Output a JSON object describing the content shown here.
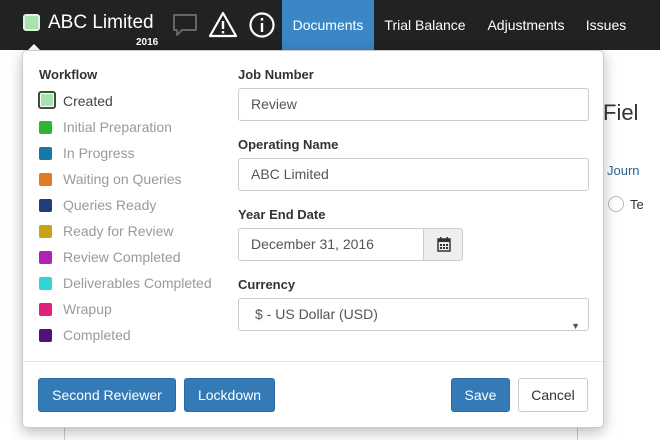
{
  "navbar": {
    "company_name": "ABC Limited",
    "year": "2016",
    "brand_color": "#a8e3ac",
    "icons": [
      "chat-icon",
      "warning-icon",
      "info-icon"
    ],
    "tabs": [
      {
        "label": "Documents",
        "active": true
      },
      {
        "label": "Trial Balance",
        "active": false
      },
      {
        "label": "Adjustments",
        "active": false
      },
      {
        "label": "Issues",
        "active": false
      }
    ]
  },
  "background": {
    "heading": "Fiel",
    "link": "Journ",
    "radio_label": "Te"
  },
  "popover": {
    "workflow_title": "Workflow",
    "workflow": [
      {
        "label": "Created",
        "color": "#a8e3ac",
        "selected": true
      },
      {
        "label": "Initial Preparation",
        "color": "#2db52d",
        "selected": false
      },
      {
        "label": "In Progress",
        "color": "#1578a8",
        "selected": false
      },
      {
        "label": "Waiting on Queries",
        "color": "#e07a25",
        "selected": false
      },
      {
        "label": "Queries Ready",
        "color": "#1f3f7a",
        "selected": false
      },
      {
        "label": "Ready for Review",
        "color": "#c9a215",
        "selected": false
      },
      {
        "label": "Review Completed",
        "color": "#b41fb4",
        "selected": false
      },
      {
        "label": "Deliverables Completed",
        "color": "#2fd6d6",
        "selected": false
      },
      {
        "label": "Wrapup",
        "color": "#e01f7a",
        "selected": false
      },
      {
        "label": "Completed",
        "color": "#4f1080",
        "selected": false
      }
    ],
    "job_number_label": "Job Number",
    "job_number_value": "Review",
    "operating_name_label": "Operating Name",
    "operating_name_value": "ABC Limited",
    "year_end_label": "Year End Date",
    "year_end_value": "December 31, 2016",
    "currency_label": "Currency",
    "currency_value": "$ - US Dollar (USD)",
    "buttons": {
      "second_reviewer": "Second Reviewer",
      "lockdown": "Lockdown",
      "save": "Save",
      "cancel": "Cancel"
    }
  }
}
